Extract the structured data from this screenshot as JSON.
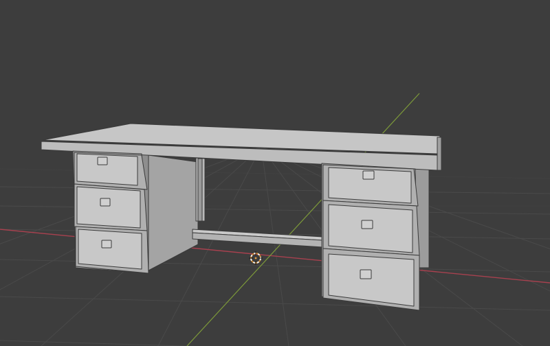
{
  "viewport": {
    "label": "",
    "background": "#3d3d3d"
  },
  "colors": {
    "grid_line": "#4a4a4a",
    "axis_x": "#a8414f",
    "axis_y": "#7d9a3a",
    "mesh_light": "#c9c9c9",
    "mesh_mid": "#b3b3b3",
    "mesh_dark": "#8e8e8e",
    "mesh_edge": "#3a3a3a",
    "cursor_ring": "#c8832a",
    "cursor_dash": "#f0f0f0"
  },
  "scene": {
    "object": "desk-mesh",
    "left_pedestal_drawers": 3,
    "right_pedestal_drawers": 3,
    "has_footrest": true,
    "shading": "solid"
  },
  "icons": {
    "cursor": "3d-cursor-icon",
    "origin": "world-origin"
  }
}
